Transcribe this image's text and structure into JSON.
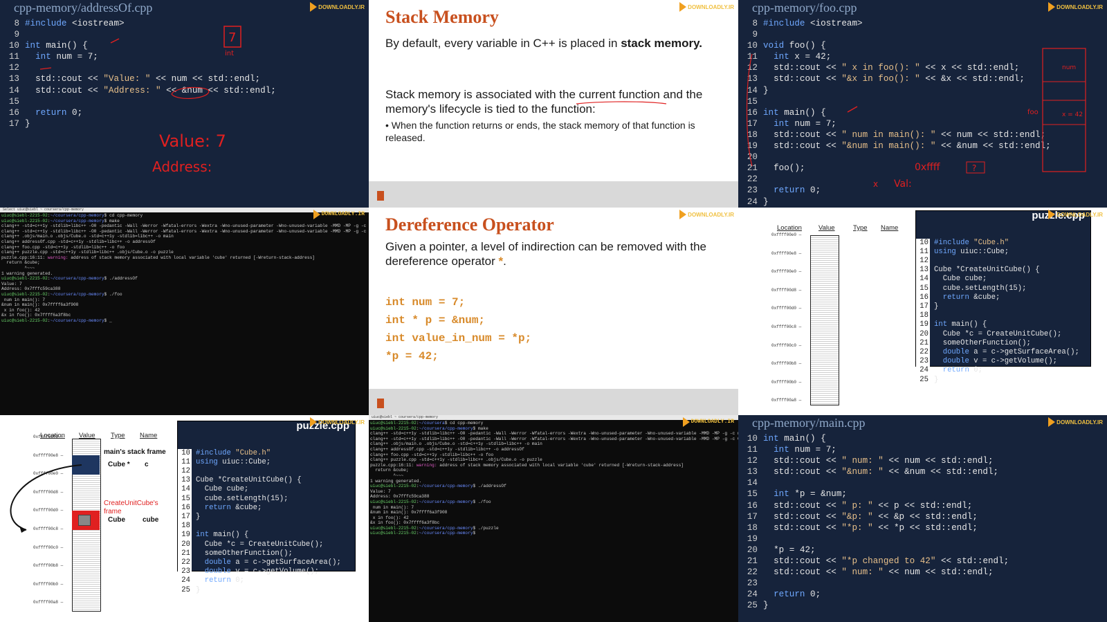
{
  "logo_text": "DOWNLOADLY.IR",
  "panel1": {
    "filename": "cpp-memory/addressOf.cpp",
    "lines": [
      {
        "n": "8",
        "t": "#include <iostream>"
      },
      {
        "n": "9",
        "t": ""
      },
      {
        "n": "10",
        "t": "int main() {"
      },
      {
        "n": "11",
        "t": "  int num = 7;"
      },
      {
        "n": "12",
        "t": ""
      },
      {
        "n": "13",
        "t": "  std::cout << \"Value: \" << num << std::endl;"
      },
      {
        "n": "14",
        "t": "  std::cout << \"Address: \" << &num << std::endl;"
      },
      {
        "n": "15",
        "t": ""
      },
      {
        "n": "16",
        "t": "  return 0;"
      },
      {
        "n": "17",
        "t": "}"
      }
    ],
    "handwriting": [
      "7",
      "int",
      "Value: 7",
      "Address:"
    ]
  },
  "panel2": {
    "title": "Stack Memory",
    "para1_a": "By default, every variable in C++ is placed in ",
    "para1_b": "stack memory.",
    "para2": "Stack memory is associated with the current function and the memory's lifecycle is tied to the function:",
    "bullet": "When the function returns or ends, the stack memory of that function is released."
  },
  "panel3": {
    "filename": "cpp-memory/foo.cpp",
    "lines": [
      {
        "n": "8",
        "t": "#include <iostream>"
      },
      {
        "n": "9",
        "t": ""
      },
      {
        "n": "10",
        "t": "void foo() {"
      },
      {
        "n": "11",
        "t": "  int x = 42;"
      },
      {
        "n": "12",
        "t": "  std::cout << \" x in foo(): \" << x << std::endl;"
      },
      {
        "n": "13",
        "t": "  std::cout << \"&x in foo(): \" << &x << std::endl;"
      },
      {
        "n": "14",
        "t": "}"
      },
      {
        "n": "15",
        "t": ""
      },
      {
        "n": "16",
        "t": "int main() {"
      },
      {
        "n": "17",
        "t": "  int num = 7;"
      },
      {
        "n": "18",
        "t": "  std::cout << \" num in main(): \" << num << std::endl;"
      },
      {
        "n": "19",
        "t": "  std::cout << \"&num in main(): \" << &num << std::endl;"
      },
      {
        "n": "20",
        "t": ""
      },
      {
        "n": "21",
        "t": "  foo();"
      },
      {
        "n": "22",
        "t": ""
      },
      {
        "n": "23",
        "t": "  return 0;"
      },
      {
        "n": "24",
        "t": "}"
      }
    ],
    "handwriting": [
      "num",
      "foo",
      "x = 42",
      "0xffff",
      "?",
      "x",
      "Val:"
    ]
  },
  "panel4": {
    "title_bar": "Select uiuc@siebl ~ coursera/cpp-memory",
    "lines": [
      "uiuc@siebl-2215-02:~/coursera/cpp-memory$ cd cpp-memory",
      "uiuc@siebl-2215-02:~/coursera/cpp-memory$ make",
      "clang++ -std=c++1y -stdlib=libc++ -O0 -pedantic -Wall -Werror -Wfatal-errors -Wextra -Wno-unused-parameter -Wno-unused-variable -MMD -MP -g -c main.cpp -o .objs/main.o",
      "clang++ -std=c++1y -stdlib=libc++ -O0 -pedantic -Wall -Werror -Wfatal-errors -Wextra -Wno-unused-parameter -Wno-unused-variable -MMD -MP -g -c Cube.cpp -o .objs/Cube.o",
      "clang++ .objs/main.o .objs/Cube.o -std=c++1y -stdlib=libc++ -o main",
      "clang++ addressOf.cpp -std=c++1y -stdlib=libc++ -o addressOf",
      "clang++ foo.cpp -std=c++1y -stdlib=libc++ -o foo",
      "clang++ puzzle.cpp -std=c++1y -stdlib=libc++ .objs/Cube.o -o puzzle",
      "puzzle.cpp:16:11: warning: address of stack memory associated with local variable 'cube' returned [-Wreturn-stack-address]",
      "  return &cube;",
      "         ^~~~",
      "1 warning generated.",
      "uiuc@siebl-2215-02:~/coursera/cpp-memory$ ./addressOf",
      "Value: 7",
      "Address: 0x7fffc59ca388",
      "uiuc@siebl-2215-02:~/coursera/cpp-memory$ ./foo",
      " num in main(): 7",
      "&num in main(): 0x7ffff6a3f908",
      " x in foo(): 42",
      "&x in foo(): 0x7ffff6a3f8bc",
      "uiuc@siebl-2215-02:~/coursera/cpp-memory$ _"
    ]
  },
  "panel5": {
    "title": "Dereference Operator",
    "para": "Given a pointer, a level of indirection can be removed with the dereference operator ",
    "op": "*",
    "code": [
      "int num = 7;",
      "int * p = &num;",
      "int value_in_num = *p;",
      "*p = 42;"
    ]
  },
  "panel6": {
    "headers": [
      "Location",
      "Value",
      "Type",
      "Name"
    ],
    "addresses": [
      "0xffff00e0",
      "0xffff00e8",
      "0xffff00e0",
      "0xffff00d8",
      "0xffff00d0",
      "0xffff00c8",
      "0xffff00c0",
      "0xffff00b8",
      "0xffff00b0",
      "0xffff00a8"
    ],
    "code_title": "puzzle.cpp",
    "code": [
      {
        "n": "10",
        "t": "#include \"Cube.h\""
      },
      {
        "n": "11",
        "t": "using uiuc::Cube;"
      },
      {
        "n": "12",
        "t": ""
      },
      {
        "n": "13",
        "t": "Cube *CreateUnitCube() {"
      },
      {
        "n": "14",
        "t": "  Cube cube;"
      },
      {
        "n": "15",
        "t": "  cube.setLength(15);"
      },
      {
        "n": "16",
        "t": "  return &cube;"
      },
      {
        "n": "17",
        "t": "}"
      },
      {
        "n": "18",
        "t": ""
      },
      {
        "n": "19",
        "t": "int main() {"
      },
      {
        "n": "20",
        "t": "  Cube *c = CreateUnitCube();"
      },
      {
        "n": "21",
        "t": "  someOtherFunction();"
      },
      {
        "n": "22",
        "t": "  double a = c->getSurfaceArea();"
      },
      {
        "n": "23",
        "t": "  double v = c->getVolume();"
      },
      {
        "n": "24",
        "t": "  return 0;"
      },
      {
        "n": "25",
        "t": "}"
      }
    ]
  },
  "panel7": {
    "headers": [
      "Location",
      "Value",
      "Type",
      "Name"
    ],
    "addresses": [
      "0xffff00f0",
      "0xffff00e8",
      "0xffff00e0",
      "0xffff00d8",
      "0xffff00d0",
      "0xffff00c8",
      "0xffff00c0",
      "0xffff00b8",
      "0xffff00b0",
      "0xffff00a8"
    ],
    "main_frame_label": "main's stack frame",
    "main_type": "Cube *",
    "main_name": "c",
    "cuc_frame_label": "CreateUnitCube's frame",
    "cuc_type": "Cube",
    "cuc_name": "cube",
    "code_title": "puzzle.cpp"
  },
  "panel8": {
    "title_bar": "uiuc@siebl ~ coursera/cpp-memory",
    "lines": [
      "uiuc@siebl-2215-02:~/coursera$ cd cpp-memory",
      "uiuc@siebl-2215-02:~/coursera/cpp-memory$ make",
      "clang++ -std=c++1y -stdlib=libc++ -O0 -pedantic -Wall -Werror -Wfatal-errors -Wextra -Wno-unused-parameter -Wno-unused-variable -MMD -MP -g -c main.cpp -o .objs/main.o",
      "clang++ -std=c++1y -stdlib=libc++ -O0 -pedantic -Wall -Werror -Wfatal-errors -Wextra -Wno-unused-parameter -Wno-unused-variable -MMD -MP -g -c Cube.cpp -o .objs/Cube.o",
      "clang++ .objs/main.o .objs/Cube.o -std=c++1y -stdlib=libc++ -o main",
      "clang++ addressOf.cpp -std=c++1y -stdlib=libc++ -o addressOf",
      "clang++ foo.cpp -std=c++1y -stdlib=libc++ -o foo",
      "clang++ puzzle.cpp -std=c++1y -stdlib=libc++ .objs/Cube.o -o puzzle",
      "puzzle.cpp:16:11: warning: address of stack memory associated with local variable 'cube' returned [-Wreturn-stack-address]",
      "  return &cube;",
      "         ^~~~",
      "1 warning generated.",
      "uiuc@siebl-2215-02:~/coursera/cpp-memory$ ./addressOf",
      "Value: 7",
      "Address: 0x7fffc59ca388",
      "uiuc@siebl-2215-02:~/coursera/cpp-memory$ ./foo",
      " num in main(): 7",
      "&num in main(): 0x7ffff6a3f908",
      " x in foo(): 42",
      "&x in foo(): 0x7ffff6a3f8bc",
      "uiuc@siebl-2215-02:~/coursera/cpp-memory$ ./puzzle",
      "uiuc@siebl-2215-02:~/coursera/cpp-memory$"
    ]
  },
  "panel9": {
    "filename": "cpp-memory/main.cpp",
    "lines": [
      {
        "n": "10",
        "t": "int main() {"
      },
      {
        "n": "11",
        "t": "  int num = 7;"
      },
      {
        "n": "12",
        "t": "  std::cout << \" num: \" << num << std::endl;"
      },
      {
        "n": "13",
        "t": "  std::cout << \"&num: \" << &num << std::endl;"
      },
      {
        "n": "14",
        "t": ""
      },
      {
        "n": "15",
        "t": "  int *p = &num;"
      },
      {
        "n": "16",
        "t": "  std::cout << \" p: \" << p << std::endl;"
      },
      {
        "n": "17",
        "t": "  std::cout << \"&p: \" << &p << std::endl;"
      },
      {
        "n": "18",
        "t": "  std::cout << \"*p: \" << *p << std::endl;"
      },
      {
        "n": "19",
        "t": ""
      },
      {
        "n": "20",
        "t": "  *p = 42;"
      },
      {
        "n": "21",
        "t": "  std::cout << \"*p changed to 42\" << std::endl;"
      },
      {
        "n": "22",
        "t": "  std::cout << \" num: \" << num << std::endl;"
      },
      {
        "n": "23",
        "t": ""
      },
      {
        "n": "24",
        "t": "  return 0;"
      },
      {
        "n": "25",
        "t": "}"
      }
    ]
  }
}
